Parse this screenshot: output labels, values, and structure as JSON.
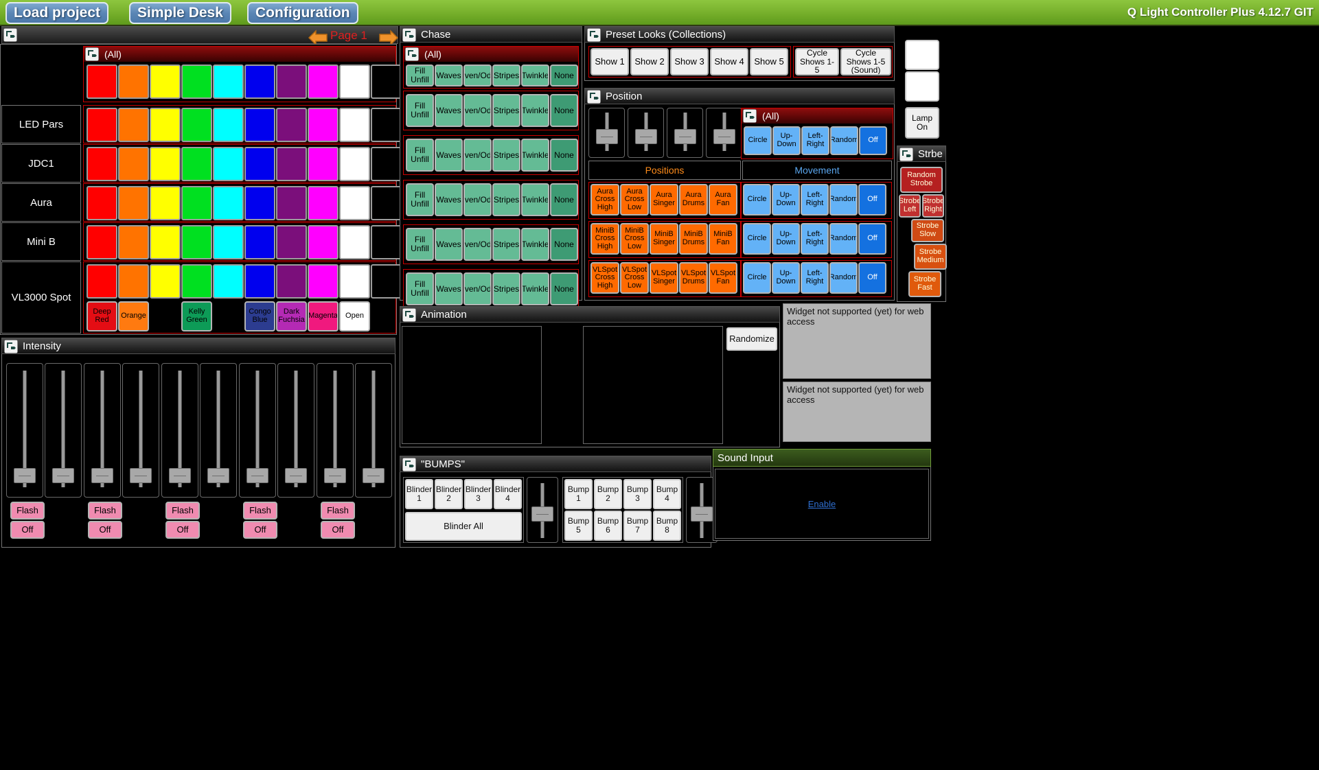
{
  "topbar": {
    "buttons": [
      "Load project",
      "Simple Desk",
      "Configuration"
    ],
    "app_title": "Q Light Controller Plus 4.12.7 GIT",
    "accent": "#8dc63f"
  },
  "page_nav": {
    "label": "Page 1",
    "prev_icon": "left-arrow-icon",
    "next_icon": "right-arrow-icon"
  },
  "color_panel": {
    "all_label": "(All)",
    "fixtures": [
      "LED Pars",
      "JDC1",
      "Aura",
      "Mini B",
      "VL3000 Spot"
    ],
    "swatches": [
      "#ff0000",
      "#ff7300",
      "#ffff00",
      "#00e020",
      "#00ffff",
      "#0000ee",
      "#7b0f7b",
      "#ff00ff",
      "#ffffff",
      "#000000"
    ],
    "gels": [
      {
        "label": "Deep Red",
        "color": "#e40d14",
        "text": "#000000"
      },
      {
        "label": "Orange",
        "color": "#ff7a10",
        "text": "#000000"
      },
      {
        "label": "",
        "color": "#000000",
        "text": "#000000"
      },
      {
        "label": "Kelly Green",
        "color": "#0d9b57",
        "text": "#000000"
      },
      {
        "label": "",
        "color": "#000000",
        "text": "#000000"
      },
      {
        "label": "Congo Blue",
        "color": "#2c3c90",
        "text": "#000000"
      },
      {
        "label": "Dark Fuchsia",
        "color": "#b42ab4",
        "text": "#000000"
      },
      {
        "label": "Magenta",
        "color": "#f0197e",
        "text": "#000000"
      },
      {
        "label": "Open",
        "color": "#ffffff",
        "text": "#000000"
      }
    ]
  },
  "chase": {
    "title": "Chase",
    "all_label": "(All)",
    "buttons": [
      "Fill Unfill",
      "Waves",
      "Even/Odd",
      "Stripes",
      "Twinkle",
      "None"
    ],
    "selected": "None",
    "rows": 6
  },
  "preset_looks": {
    "title": "Preset Looks (Collections)",
    "shows": [
      "Show 1",
      "Show 2",
      "Show 3",
      "Show 4",
      "Show 5"
    ],
    "cycles": [
      "Cycle Shows 1-5",
      "Cycle Shows 1-5 (Sound)"
    ]
  },
  "position": {
    "title": "Position",
    "positions_label": "Positions",
    "movement_label": "Movement",
    "all_label": "(All)",
    "sliders": 4,
    "position_rows": [
      [
        "Aura Cross High",
        "Aura Cross Low",
        "Aura Singer",
        "Aura Drums",
        "Aura Fan"
      ],
      [
        "MiniB Cross High",
        "MiniB Cross Low",
        "MiniB Singer",
        "MiniB Drums",
        "MiniB Fan"
      ],
      [
        "VLSpot Cross High",
        "VLSpot Cross Low",
        "VLSpot Singer",
        "VLSpot Drums",
        "VLSpot Fan"
      ]
    ],
    "movement_buttons": [
      "Circle",
      "Up-Down",
      "Left-Right",
      "Random",
      "Off"
    ],
    "movement_selected": "Off",
    "movement_rows": 4
  },
  "strobe": {
    "title": "Strbe",
    "lamp_on": "Lamp On",
    "buttons": [
      {
        "label": "Random Strobe",
        "color": "#b52020"
      },
      {
        "label": "Strobe Left",
        "color": "#c03030"
      },
      {
        "label": "Strobe Right",
        "color": "#c03030"
      },
      {
        "label": "Strobe Slow",
        "color": "#d04a14"
      },
      {
        "label": "Strobe Medium",
        "color": "#d85010"
      },
      {
        "label": "Strobe Fast",
        "color": "#e05a0c"
      }
    ]
  },
  "animation": {
    "title": "Animation",
    "randomize_label": "Randomize",
    "unsupported_text": "Widget not supported (yet) for web access"
  },
  "bumps": {
    "title": "\"BUMPS\"",
    "blinders": [
      "Blinder 1",
      "Blinder 2",
      "Blinder 3",
      "Blinder 4"
    ],
    "blinder_all": "Blinder All",
    "bumps": [
      "Bump 1",
      "Bump 2",
      "Bump 3",
      "Bump 4",
      "Bump 5",
      "Bump 6",
      "Bump 7",
      "Bump 8"
    ]
  },
  "sound_input": {
    "title": "Sound Input",
    "enable_label": "Enable"
  },
  "intensity": {
    "title": "Intensity",
    "groups": 5,
    "flash_label": "Flash",
    "off_label": "Off"
  }
}
